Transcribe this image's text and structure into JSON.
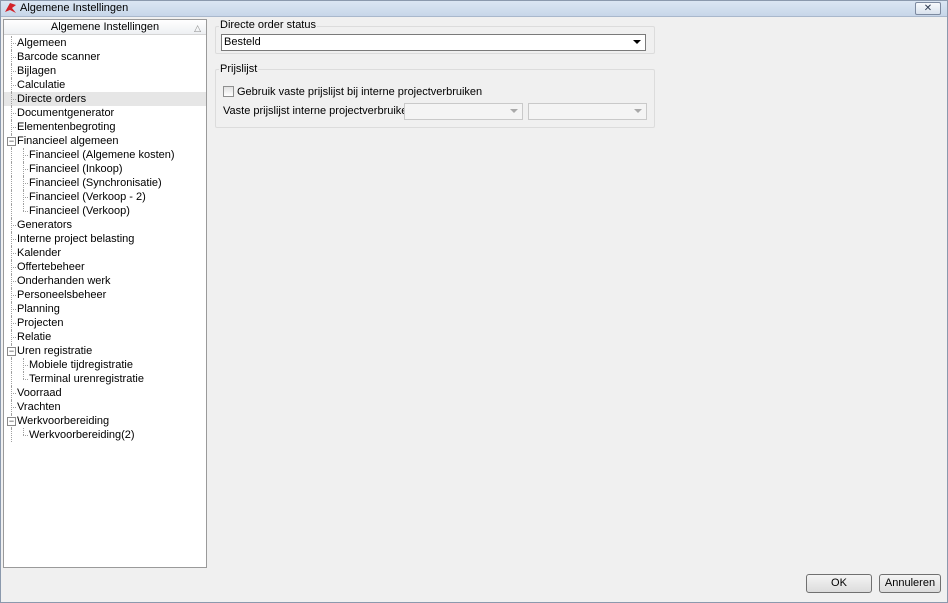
{
  "window": {
    "title": "Algemene Instellingen",
    "close_symbol": "✕",
    "app_icon": "app-logo-icon"
  },
  "tree": {
    "header": "Algemene Instellingen",
    "sort_symbol": "△",
    "items": [
      {
        "label": "Algemeen",
        "level": 0
      },
      {
        "label": "Barcode scanner",
        "level": 0
      },
      {
        "label": "Bijlagen",
        "level": 0
      },
      {
        "label": "Calculatie",
        "level": 0
      },
      {
        "label": "Directe orders",
        "level": 0,
        "selected": true
      },
      {
        "label": "Documentgenerator",
        "level": 0
      },
      {
        "label": "Elementenbegroting",
        "level": 0
      },
      {
        "label": "Financieel algemeen",
        "level": 0,
        "expander": "⊟"
      },
      {
        "label": "Financieel (Algemene kosten)",
        "level": 1
      },
      {
        "label": "Financieel (Inkoop)",
        "level": 1
      },
      {
        "label": "Financieel (Synchronisatie)",
        "level": 1
      },
      {
        "label": "Financieel (Verkoop - 2)",
        "level": 1
      },
      {
        "label": "Financieel (Verkoop)",
        "level": 1
      },
      {
        "label": "Generators",
        "level": 0
      },
      {
        "label": "Interne project belasting",
        "level": 0
      },
      {
        "label": "Kalender",
        "level": 0
      },
      {
        "label": "Offertebeheer",
        "level": 0
      },
      {
        "label": "Onderhanden werk",
        "level": 0
      },
      {
        "label": "Personeelsbeheer",
        "level": 0
      },
      {
        "label": "Planning",
        "level": 0
      },
      {
        "label": "Projecten",
        "level": 0
      },
      {
        "label": "Relatie",
        "level": 0
      },
      {
        "label": "Uren registratie",
        "level": 0,
        "expander": "⊟"
      },
      {
        "label": "Mobiele tijdregistratie",
        "level": 1
      },
      {
        "label": "Terminal urenregistratie",
        "level": 1
      },
      {
        "label": "Voorraad",
        "level": 0
      },
      {
        "label": "Vrachten",
        "level": 0
      },
      {
        "label": "Werkvoorbereiding",
        "level": 0,
        "expander": "⊟"
      },
      {
        "label": "Werkvoorbereiding(2)",
        "level": 1
      }
    ]
  },
  "directe_order_status": {
    "title": "Directe order status",
    "selected_value": "Besteld"
  },
  "prijslijst": {
    "title": "Prijslijst",
    "checkbox_label": "Gebruik vaste prijslijst bij interne projectverbruiken",
    "checkbox_checked": false,
    "field_label": "Vaste prijslijst interne projectverbruiken",
    "select1_value": "",
    "select2_value": ""
  },
  "buttons": {
    "ok": "OK",
    "cancel": "Annuleren"
  },
  "colors": {
    "selection": "#e6e6e6",
    "app_icon": "#d3222a"
  }
}
